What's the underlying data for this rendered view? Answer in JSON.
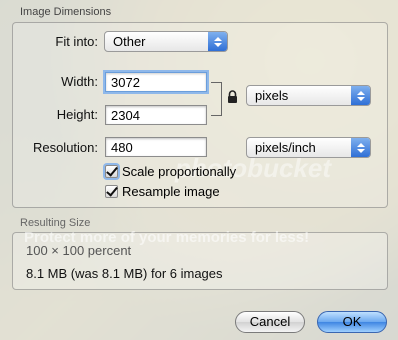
{
  "dialog": {
    "section_image_dimensions": "Image Dimensions",
    "fit_into": {
      "label": "Fit into:",
      "value": "Other"
    },
    "width": {
      "label": "Width:",
      "value": "3072"
    },
    "height": {
      "label": "Height:",
      "value": "2304"
    },
    "size_unit": "pixels",
    "resolution": {
      "label": "Resolution:",
      "value": "480",
      "unit": "pixels/inch"
    },
    "scale_proportionally": {
      "label": "Scale proportionally",
      "checked": true
    },
    "resample_image": {
      "label": "Resample image",
      "checked": true
    },
    "section_resulting_size": "Resulting Size",
    "watermark": "Protect more of your memories for less!",
    "watermark_logo": "photobucket",
    "result_percent": "100 × 100 percent",
    "result_size": "8.1 MB (was 8.1 MB) for 6 images",
    "cancel_label": "Cancel",
    "ok_label": "OK"
  },
  "colors": {
    "accent": "#3f86e2",
    "focus_ring": "#8fb8ea"
  },
  "icons": [
    "lock-icon",
    "popup-arrows-icon",
    "checkmark-icon"
  ]
}
